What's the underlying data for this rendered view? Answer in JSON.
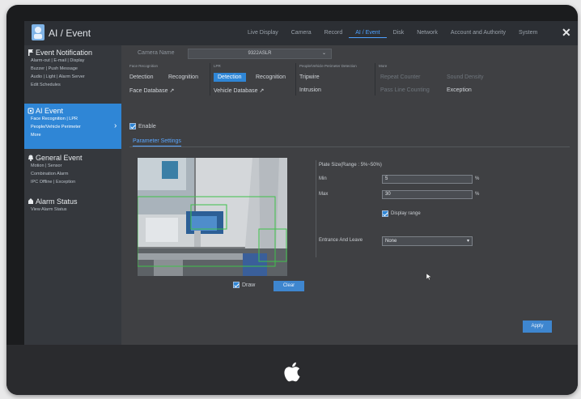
{
  "app": {
    "title": "AI / Event"
  },
  "nav": [
    {
      "label": "Live Display"
    },
    {
      "label": "Camera"
    },
    {
      "label": "Record"
    },
    {
      "label": "AI / Event",
      "active": true
    },
    {
      "label": "Disk"
    },
    {
      "label": "Network"
    },
    {
      "label": "Account and Authority"
    },
    {
      "label": "System"
    }
  ],
  "close_label": "✕",
  "sidebar": {
    "event_notification": {
      "title": "Event Notification",
      "items": [
        "Alarm-out | E-mail | Display",
        "Buzzer | Push Message",
        "Audio | Light | Alarm Server",
        "Edit Schedules"
      ]
    },
    "ai_event": {
      "title": "AI Event",
      "items": [
        "Face Recognition | LPR",
        "People/Vehicle Perimeter",
        "More"
      ]
    },
    "general_event": {
      "title": "General Event",
      "items": [
        "Motion | Sensor",
        "Combination Alarm",
        "IPC Offline | Exception"
      ]
    },
    "alarm_status": {
      "title": "Alarm Status",
      "items": [
        "View Alarm Status"
      ]
    }
  },
  "camera": {
    "label": "Camera Name",
    "value": "9322ASLR"
  },
  "groups": [
    {
      "title": "Face Recognition",
      "options": [
        "Detection",
        "Recognition",
        "Face Database"
      ]
    },
    {
      "title": "LPR",
      "options": [
        "Detection",
        "Recognition",
        "Vehicle Database"
      ]
    },
    {
      "title": "People/Vehicle Perimeter Detection",
      "options": [
        "Tripwire",
        "Intrusion"
      ]
    },
    {
      "title": "More",
      "options": [
        "Repeat Counter",
        "Sound Density",
        "Pass Line Counting",
        "Exception"
      ]
    }
  ],
  "enable_label": "Enable",
  "subtab_label": "Parameter Settings",
  "draw_label": "Draw",
  "clear_label": "Clear",
  "settings": {
    "plate_size_label": "Plate Size(Range : 5%~50%)",
    "min_label": "Min",
    "min_value": "5",
    "max_label": "Max",
    "max_value": "30",
    "percent": "%",
    "display_range_label": "Display range",
    "entrance_label": "Entrance And Leave",
    "entrance_value": "None"
  },
  "apply_label": "Apply"
}
